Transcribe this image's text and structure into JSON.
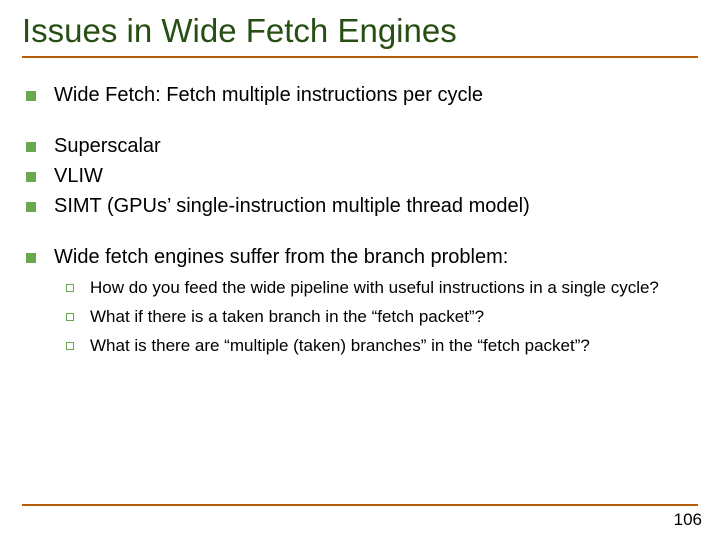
{
  "title": "Issues in Wide Fetch Engines",
  "bullets_group1": [
    "Wide Fetch: Fetch multiple instructions per cycle"
  ],
  "bullets_group2": [
    "Superscalar",
    "VLIW",
    "SIMT (GPUs’ single-instruction multiple thread model)"
  ],
  "bullets_group3": [
    "Wide fetch engines suffer from the branch problem:"
  ],
  "subbullets": [
    "How do you feed the wide pipeline with useful instructions in a single cycle?",
    "What if there is a taken branch in the “fetch packet”?",
    "What is there are “multiple (taken) branches” in the “fetch packet”?"
  ],
  "page_number": "106"
}
